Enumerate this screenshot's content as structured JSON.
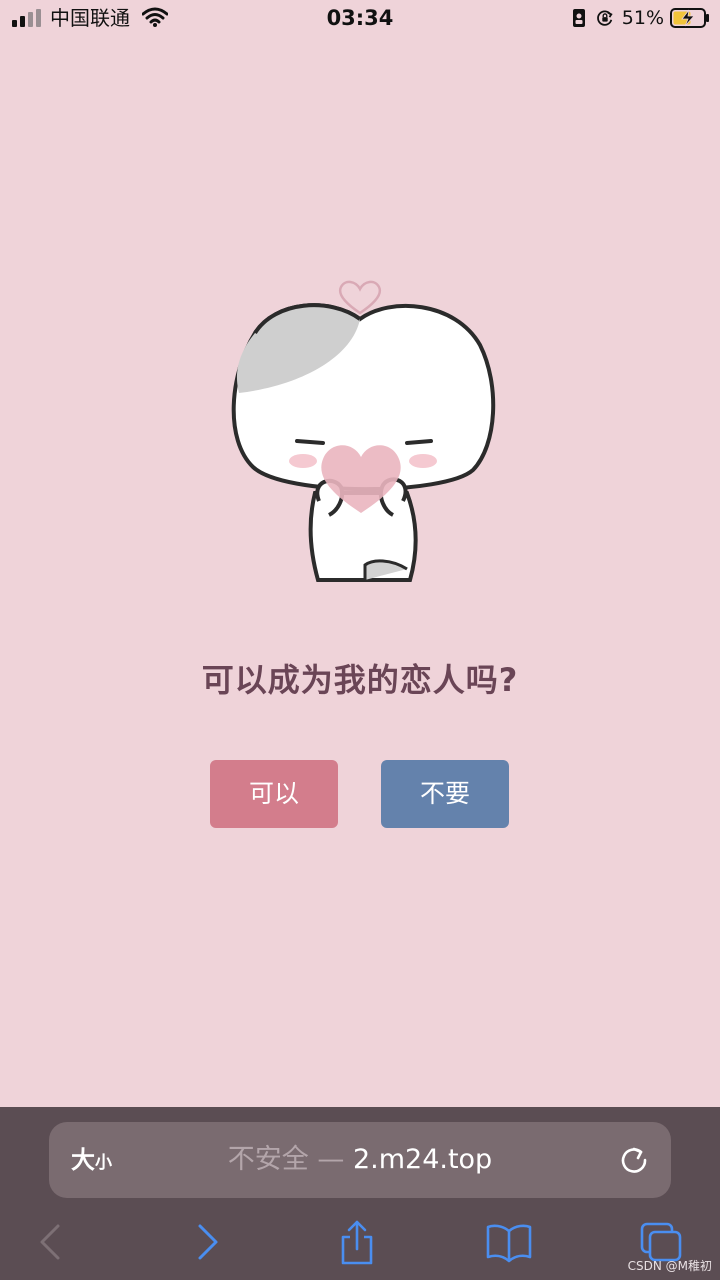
{
  "status_bar": {
    "carrier": "中国联通",
    "time": "03:34",
    "battery_percent": "51%",
    "icons": [
      "signal-icon",
      "wifi-icon",
      "portrait-lock-icon",
      "rotation-lock-icon",
      "battery-charging-icon"
    ]
  },
  "content": {
    "question": "可以成为我的恋人吗?",
    "illustration": "mascot-holding-heart",
    "buttons": {
      "yes": "可以",
      "no": "不要"
    }
  },
  "browser": {
    "text_size_big": "大",
    "text_size_small": "小",
    "insecure_label": "不安全",
    "separator": " — ",
    "domain": "2.m24.top",
    "toolbar": [
      "back-icon",
      "forward-icon",
      "share-icon",
      "bookmarks-icon",
      "tabs-icon"
    ]
  },
  "watermark": "CSDN @M稚初",
  "colors": {
    "background": "#efd3d9",
    "question_text": "#6a4556",
    "yes_button": "#d37d8c",
    "no_button": "#6482ac",
    "browser_bar": "#5b4d53",
    "address_field": "#7a6b70",
    "toolbar_active": "#4a8ef0"
  }
}
